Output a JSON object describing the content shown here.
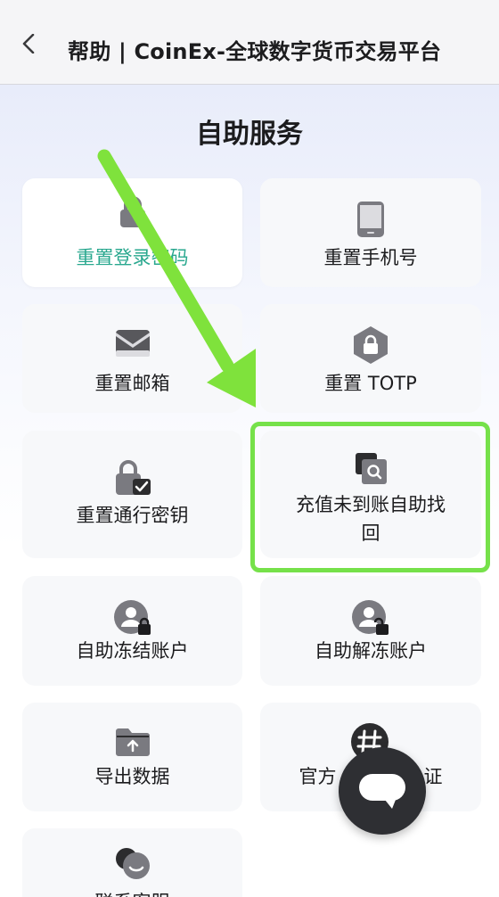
{
  "nav": {
    "title": "帮助 | CoinEx-全球数字货币交易平台"
  },
  "section": {
    "title": "自助服务"
  },
  "services": [
    {
      "label": "重置登录密码",
      "icon": "lock-icon",
      "color": "#2aa88f"
    },
    {
      "label": "重置手机号",
      "icon": "phone-icon"
    },
    {
      "label": "重置邮箱",
      "icon": "envelope-icon"
    },
    {
      "label": "重置 TOTP",
      "icon": "hexagon-lock-icon"
    },
    {
      "label": "重置通行密钥",
      "icon": "passkey-lock-icon"
    },
    {
      "label_line1": "充值未到账自助找",
      "label_line2": "回",
      "icon": "search-document-icon"
    },
    {
      "label": "自助冻结账户",
      "icon": "user-lock-icon"
    },
    {
      "label": "自助解冻账户",
      "icon": "user-unlock-icon"
    },
    {
      "label": "导出数据",
      "icon": "folder-upload-icon"
    },
    {
      "label": "官方",
      "label_tail": "证",
      "icon": "hashtag-icon"
    },
    {
      "label": "联系客服",
      "icon": "chat-icon"
    }
  ],
  "colors": {
    "highlight": "#76e14a",
    "arrow": "#7fe23c",
    "accent": "#2aa88f"
  }
}
